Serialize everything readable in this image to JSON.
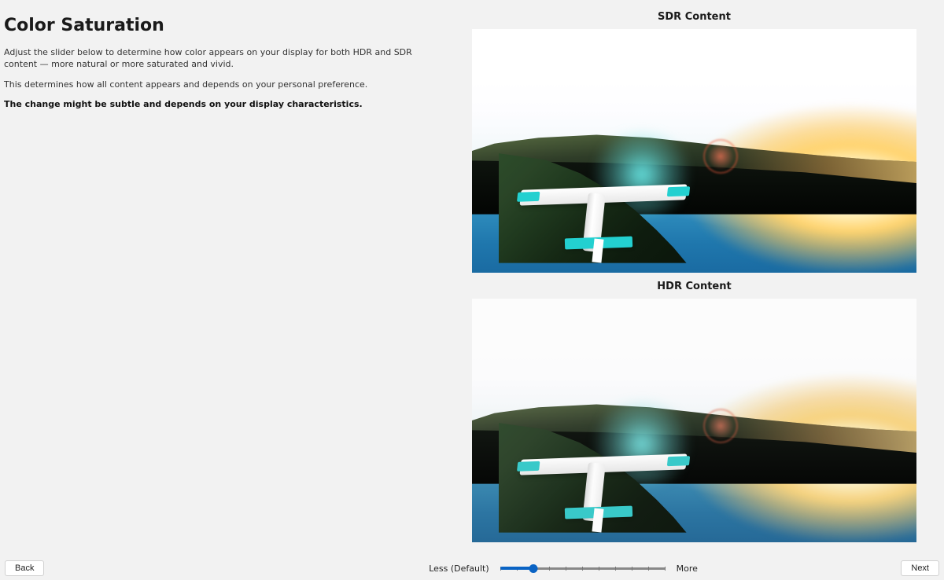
{
  "page": {
    "title": "Color Saturation",
    "desc1": "Adjust the slider below to determine how color appears on your display for both HDR and SDR content — more natural or more saturated and vivid.",
    "desc2": "This determines how all content appears and depends on your personal preference.",
    "desc3": "The change might be subtle and depends on your display characteristics."
  },
  "previews": {
    "sdr_label": "SDR Content",
    "hdr_label": "HDR Content"
  },
  "slider": {
    "left_label": "Less (Default)",
    "right_label": "More",
    "value_percent": 20,
    "ticks": 11
  },
  "buttons": {
    "back": "Back",
    "next": "Next"
  }
}
